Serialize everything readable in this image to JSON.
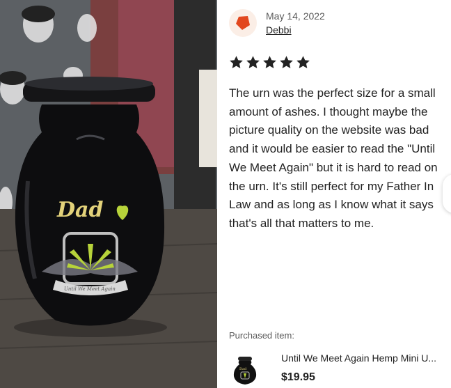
{
  "photo": {
    "alt_icon": "urn-photo",
    "urn_label": "Dad",
    "ribbon_text": "Until We Meet Again"
  },
  "review": {
    "date": "May 14, 2022",
    "reviewer": "Debbi",
    "rating": 5,
    "rating_max": 5,
    "text": "The urn was the perfect size for a small amount of ashes. I thought maybe the picture quality on the website was bad and it would be easier to read the \"Until We Meet Again\" but it is hard to read on the urn. It's still perfect for my Father In Law and as long as I know what it says that's all that matters to me."
  },
  "purchased": {
    "label": "Purchased item:",
    "item_title": "Until We Meet Again Hemp Mini U...",
    "item_price": "$19.95"
  },
  "colors": {
    "avatar_bg": "#fbeee6",
    "avatar_shape": "#e2471e",
    "star": "#222222",
    "leaf": "#b7d33a",
    "label_yellow": "#e3d27a"
  }
}
